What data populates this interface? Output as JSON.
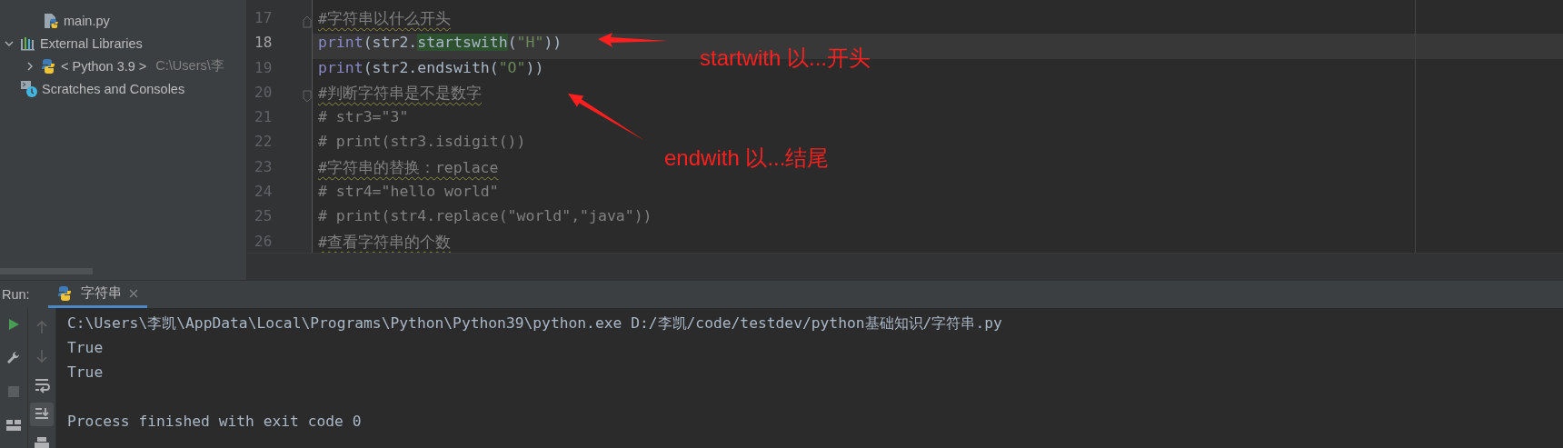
{
  "project_tree": [
    {
      "kind": "file",
      "label": "main.py"
    },
    {
      "kind": "libraries",
      "label": "External Libraries",
      "expanded": true,
      "children": [
        {
          "kind": "sdk",
          "label": "< Python 3.9 >",
          "detail": "C:\\Users\\李",
          "expanded": false
        }
      ]
    },
    {
      "kind": "scratches",
      "label": "Scratches and Consoles"
    }
  ],
  "editor": {
    "lines": [
      {
        "number": "17",
        "current": false,
        "kind": "fold-start",
        "tokens": [
          {
            "kind": "comment",
            "text": "#字符串以什么开头",
            "typo": true
          }
        ]
      },
      {
        "number": "18",
        "current": true,
        "tokens": [
          {
            "kind": "builtin",
            "text": "print"
          },
          {
            "kind": "plain",
            "text": "(str2."
          },
          {
            "kind": "plain",
            "text": "startswith",
            "highlight": true
          },
          {
            "kind": "plain",
            "text": "("
          },
          {
            "kind": "string",
            "text": "\"H\""
          },
          {
            "kind": "plain",
            "text": "))"
          }
        ]
      },
      {
        "number": "19",
        "current": false,
        "tokens": [
          {
            "kind": "builtin",
            "text": "print"
          },
          {
            "kind": "plain",
            "text": "(str2.endswith("
          },
          {
            "kind": "string",
            "text": "\"O\""
          },
          {
            "kind": "plain",
            "text": "))"
          }
        ]
      },
      {
        "number": "20",
        "current": false,
        "kind": "fold-end",
        "tokens": [
          {
            "kind": "comment",
            "text": "#判断字符串是不是数字",
            "typo": true
          }
        ]
      },
      {
        "number": "21",
        "current": false,
        "tokens": [
          {
            "kind": "comment",
            "text": "# str3=\"3\""
          }
        ]
      },
      {
        "number": "22",
        "current": false,
        "tokens": [
          {
            "kind": "comment",
            "text": "# print(str3.isdigit())"
          }
        ]
      },
      {
        "number": "23",
        "current": false,
        "tokens": [
          {
            "kind": "comment",
            "text": "#字符串的替换：replace",
            "typo": true
          }
        ]
      },
      {
        "number": "24",
        "current": false,
        "tokens": [
          {
            "kind": "comment",
            "text": "# str4=\"hello world\""
          }
        ]
      },
      {
        "number": "25",
        "current": false,
        "tokens": [
          {
            "kind": "comment",
            "text": "# print(str4.replace(\"world\",\"java\"))"
          }
        ]
      },
      {
        "number": "26",
        "current": false,
        "tokens": [
          {
            "kind": "comment",
            "text": "#查看字符串的个数",
            "typo": true
          }
        ]
      }
    ]
  },
  "annotations": [
    {
      "text": "startwith 以...开头"
    },
    {
      "text": "endwith 以...结尾"
    }
  ],
  "run": {
    "label": "Run:",
    "tabs": [
      {
        "label": "字符串",
        "selected": true
      }
    ],
    "toolbar": [
      {
        "kind": "run",
        "disabled": false
      },
      {
        "kind": "settings",
        "disabled": false
      },
      {
        "kind": "stop",
        "disabled": true
      },
      {
        "kind": "layout",
        "disabled": false
      }
    ],
    "console_toolbar": [
      {
        "kind": "up",
        "disabled": true,
        "selected": false
      },
      {
        "kind": "down",
        "disabled": true,
        "selected": false
      },
      {
        "kind": "wrap",
        "disabled": false,
        "selected": false
      },
      {
        "kind": "scroll-end",
        "disabled": false,
        "selected": true
      },
      {
        "kind": "print",
        "disabled": false,
        "selected": false
      }
    ],
    "output": [
      {
        "text": "C:\\Users\\李凯\\AppData\\Local\\Programs\\Python\\Python39\\python.exe D:/李凯/code/testdev/python基础知识/字符串.py",
        "space_before": false
      },
      {
        "text": "True",
        "space_before": false
      },
      {
        "text": "True",
        "space_before": false
      },
      {
        "text": "Process finished with exit code 0",
        "space_before": true
      }
    ]
  }
}
